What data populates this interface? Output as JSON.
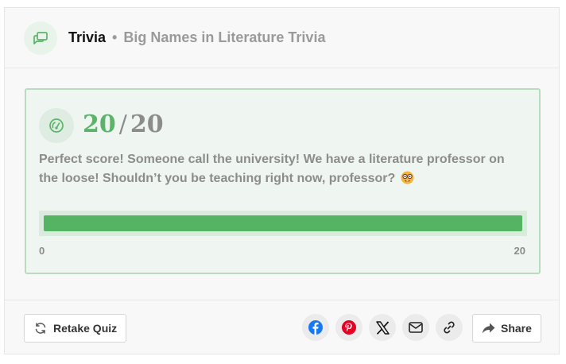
{
  "header": {
    "brand": "Trivia",
    "separator": "•",
    "subtitle": "Big Names in Literature Trivia",
    "icon": "chat-bubbles-icon"
  },
  "result": {
    "score": "20",
    "slash": "/",
    "total": "20",
    "icon": "speedometer-icon",
    "message": "Perfect score! Someone call the university! We have a literature professor on the loose! Shouldn’t you be teaching right now, professor?",
    "emoji": "nerd-face-emoji",
    "progress": {
      "value": 20,
      "min_label": "0",
      "max_label": "20",
      "fraction": 1.0
    }
  },
  "footer": {
    "retake_label": "Retake Quiz",
    "share_label": "Share",
    "social": [
      "facebook",
      "pinterest",
      "x",
      "email",
      "copy-link"
    ]
  },
  "colors": {
    "accent_green": "#55b463",
    "score_green": "#5cb46a",
    "panel_bg": "#eff5f0",
    "panel_border": "#b9dcc0",
    "facebook_blue": "#1877f2",
    "pinterest_red": "#e60023"
  }
}
